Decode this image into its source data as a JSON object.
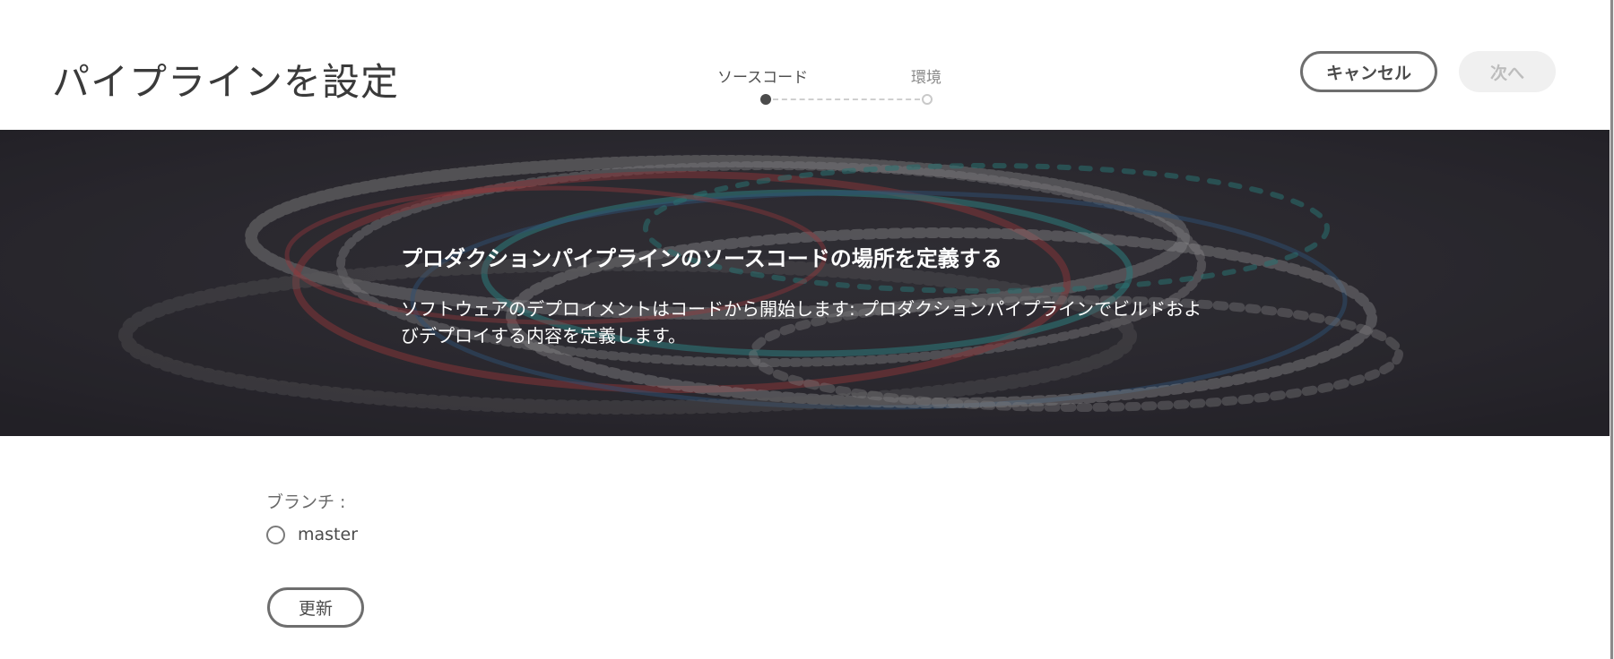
{
  "header": {
    "title": "パイプラインを設定",
    "steps": [
      {
        "label": "ソースコード",
        "state": "active"
      },
      {
        "label": "環境",
        "state": "inactive"
      }
    ],
    "cancel_label": "キャンセル",
    "next_label": "次へ"
  },
  "hero": {
    "title": "プロダクションパイプラインのソースコードの場所を定義する",
    "description": "ソフトウェアのデプロイメントはコードから開始します: プロダクションパイプラインでビルドおよびデプロイする内容を定義します。"
  },
  "branch": {
    "label": "ブランチ :",
    "options": [
      {
        "label": "master",
        "selected": false
      }
    ],
    "refresh_label": "更新"
  },
  "colors": {
    "accent_dark": "#4b4b4b",
    "hero_bg": "#2a292e",
    "disabled_bg": "#f0f0f0"
  }
}
